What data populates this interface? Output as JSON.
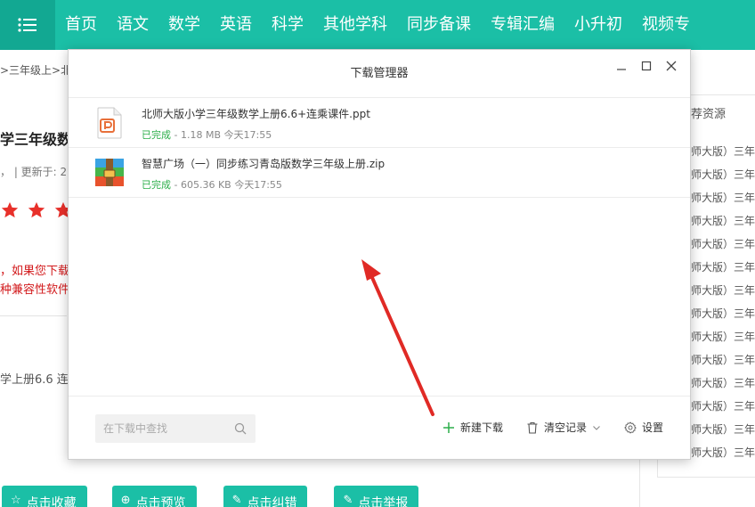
{
  "topnav": {
    "menu_icon": "hamburger-icon",
    "items": [
      "首页",
      "语文",
      "数学",
      "英语",
      "科学",
      "其他学科",
      "同步备课",
      "专辑汇编",
      "小升初",
      "视频专"
    ]
  },
  "page": {
    "breadcrumb": ">三年级上>北",
    "title": "学三年级数",
    "meta": "，  | 更新于: 2",
    "rating_stars": 3,
    "notice_line1": "，如果您下载",
    "notice_line2": "种兼容性软件",
    "file_desc": "学上册6.6 连",
    "actions": [
      {
        "icon": "star-outline-icon",
        "label": "点击收藏"
      },
      {
        "icon": "preview-icon",
        "label": "点击预览"
      },
      {
        "icon": "edit-icon",
        "label": "点击纠错"
      },
      {
        "icon": "report-icon",
        "label": "点击举报"
      }
    ]
  },
  "recommend": {
    "title": "荐资源",
    "items": [
      "师大版）三年",
      "师大版）三年",
      "师大版）三年",
      "师大版）三年",
      "师大版）三年",
      "师大版）三年",
      "师大版）三年",
      "师大版）三年",
      "师大版）三年",
      "师大版）三年",
      "师大版）三年",
      "师大版）三年",
      "师大版）三年",
      "师大版）三年"
    ]
  },
  "dialog": {
    "title": "下载管理器",
    "controls": {
      "minimize": "minimize-icon",
      "maximize": "maximize-icon",
      "close": "close-icon"
    },
    "downloads": [
      {
        "icon": "ppt-file-icon",
        "name": "北师大版小学三年级数学上册6.6+连乘课件.ppt",
        "status": "已完成",
        "size": "1.18 MB",
        "time": "今天17:55"
      },
      {
        "icon": "zip-archive-icon",
        "name": "智慧广场（一）同步练习青岛版数学三年级上册.zip",
        "status": "已完成",
        "size": "605.36 KB",
        "time": "今天17:55"
      }
    ],
    "search": {
      "placeholder": "在下载中查找",
      "value": ""
    },
    "footer": {
      "new_download": "新建下载",
      "clear_records": "清空记录",
      "settings": "设置"
    }
  },
  "colors": {
    "brand": "#1bbfa6",
    "status_done": "#2cae4a",
    "notice_red": "#d2191b",
    "annotation_arrow": "#e02a25"
  }
}
